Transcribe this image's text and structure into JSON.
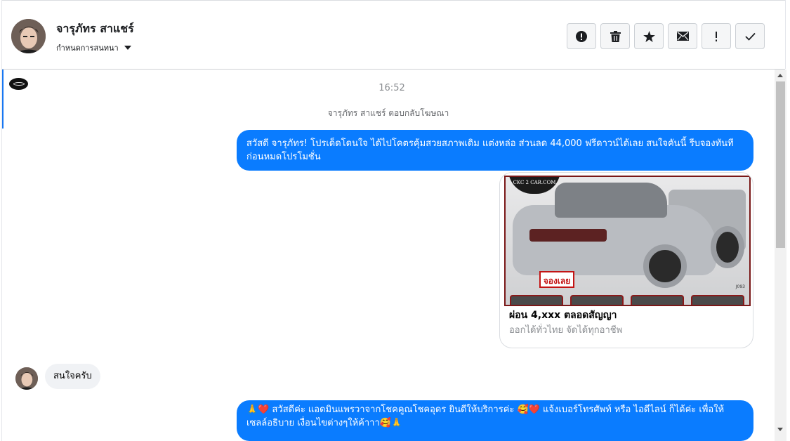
{
  "header": {
    "contact_name": "จารุภัทร สาแชร์",
    "conversation_settings": "กำหนดการสนทนา",
    "toolbar": [
      {
        "name": "report-button",
        "icon": "alert-circle-icon"
      },
      {
        "name": "delete-button",
        "icon": "trash-icon"
      },
      {
        "name": "star-button",
        "icon": "star-icon"
      },
      {
        "name": "mark-unread-button",
        "icon": "envelope-icon"
      },
      {
        "name": "spam-button",
        "icon": "exclamation-icon"
      },
      {
        "name": "done-button",
        "icon": "checkmark-icon"
      }
    ]
  },
  "conversation": {
    "timestamp": "16:52",
    "reply_note": "จารุภัทร สาแชร์ ตอบกลับโฆษณา",
    "message_1": "สวัสดี จารุภัทร! โปรเด็ดโดนใจ ได้ไปโคตรคุ้มสวยสภาพเดิม แต่งหล่อ  ส่วนลด 44,000 ฟรีดาวน์ได้เลย  สนใจคันนี้ รีบจองทันทีก่อนหมดโปรโมชั่น",
    "card": {
      "logo_text": "CKC 2 CAR.COM",
      "badge_text": "จองเลย",
      "image_code": "J093",
      "title": "ผ่อน 4,xxx ตลอดสัญญา",
      "subtitle": "ออกได้ทั่วไทย จัดได้ทุกอาชีพ"
    },
    "incoming_message": "สนใจครับ",
    "message_3": "🙏❤️  สวัสดีค่ะ แอดมินแพรวาจากโชคคูณโชคอุดร ยินดีให้บริการค่ะ  🥰❤️ แจ้งเบอร์โทรศัพท์ หรือ ไอดีไลน์ ก็ได้ค่ะ เพื่อให้เซลล์อธิบาย เงื่อนไขต่างๆให้ค้าาา🥰🙏"
  },
  "colors": {
    "outgoing_bubble": "#0a7cff",
    "incoming_bubble": "#f0f2f5",
    "accent": "#1877f2"
  }
}
